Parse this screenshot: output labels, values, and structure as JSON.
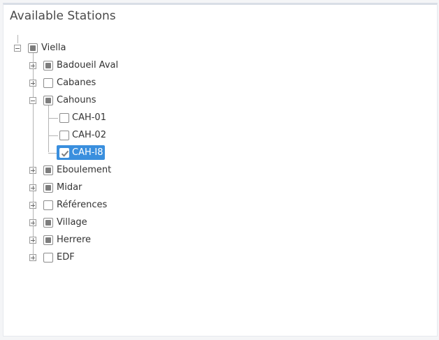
{
  "panel": {
    "title": "Available Stations"
  },
  "tree": {
    "root": {
      "label": "Viella",
      "expanded": true,
      "check": "partial"
    },
    "children": [
      {
        "label": "Badoueil Aval",
        "expanded": false,
        "check": "partial"
      },
      {
        "label": "Cabanes",
        "expanded": false,
        "check": "unchecked"
      },
      {
        "label": "Cahouns",
        "expanded": true,
        "check": "partial",
        "children": [
          {
            "label": "CAH-01",
            "check": "unchecked"
          },
          {
            "label": "CAH-02",
            "check": "unchecked"
          },
          {
            "label": "CAH-I8",
            "check": "checked",
            "selected": true
          }
        ]
      },
      {
        "label": "Eboulement",
        "expanded": false,
        "check": "partial"
      },
      {
        "label": "Midar",
        "expanded": false,
        "check": "partial"
      },
      {
        "label": "Références",
        "expanded": false,
        "check": "unchecked"
      },
      {
        "label": "Village",
        "expanded": false,
        "check": "partial"
      },
      {
        "label": "Herrere",
        "expanded": false,
        "check": "partial"
      },
      {
        "label": "EDF",
        "expanded": false,
        "check": "unchecked"
      }
    ]
  },
  "colors": {
    "selection": "#3a8fde",
    "partial_fill": "#7d7d7d",
    "text": "#333333"
  }
}
